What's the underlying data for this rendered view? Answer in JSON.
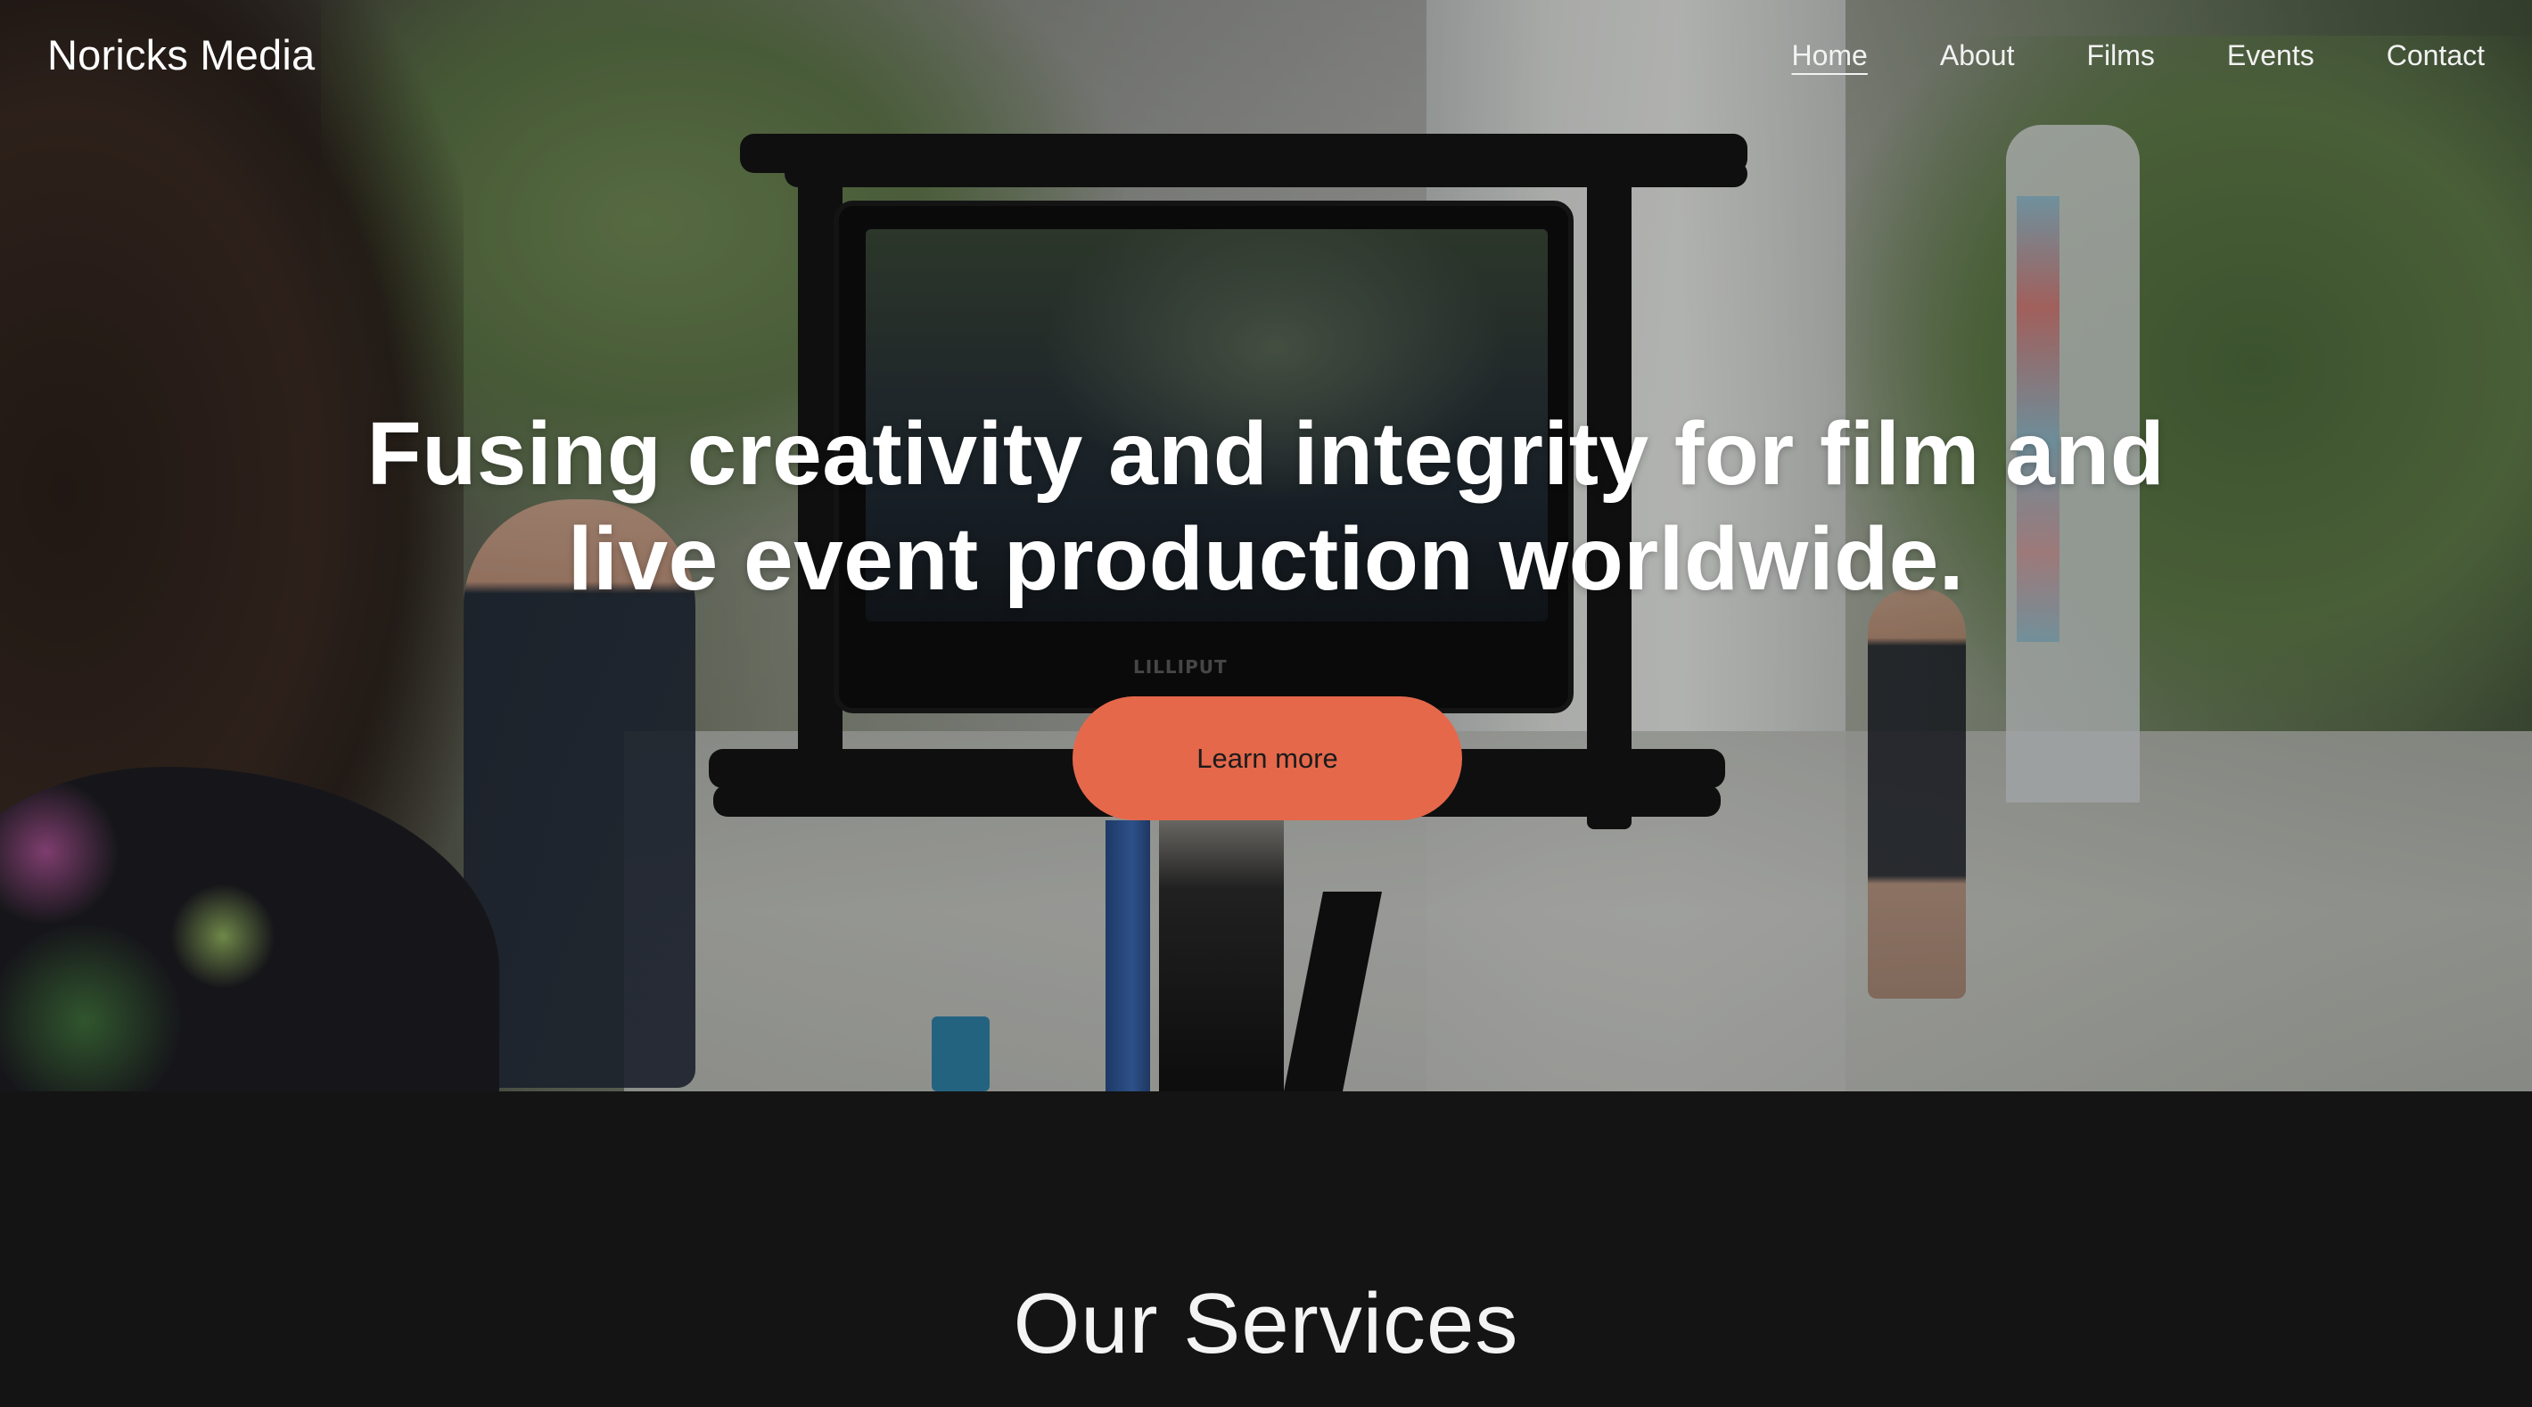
{
  "brand": {
    "name": "Noricks Media"
  },
  "nav": {
    "items": [
      {
        "label": "Home",
        "active": true
      },
      {
        "label": "About",
        "active": false
      },
      {
        "label": "Films",
        "active": false
      },
      {
        "label": "Events",
        "active": false
      },
      {
        "label": "Contact",
        "active": false
      }
    ]
  },
  "hero": {
    "headline_line1": "Fusing creativity and integrity for film and",
    "headline_line2": "live event production worldwide.",
    "cta_label": "Learn more",
    "monitor_brand": "LILLIPUT"
  },
  "services": {
    "title": "Our Services"
  },
  "colors": {
    "accent": "#e5684b",
    "page_background": "#141414",
    "text": "#ffffff"
  }
}
